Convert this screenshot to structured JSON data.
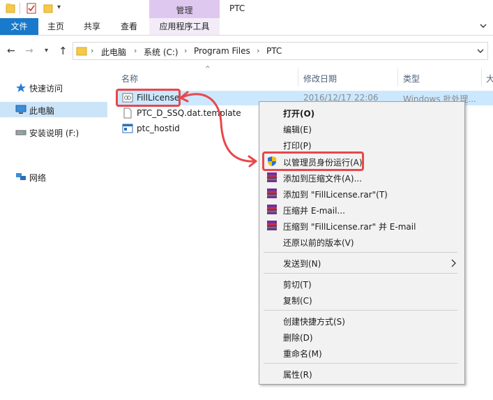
{
  "window": {
    "title": "PTC"
  },
  "ribbon": {
    "context_group": "管理",
    "tabs": [
      "文件",
      "主页",
      "共享",
      "查看",
      "应用程序工具"
    ]
  },
  "address": {
    "crumbs": [
      "此电脑",
      "系统 (C:)",
      "Program Files",
      "PTC"
    ]
  },
  "nav": {
    "items": [
      {
        "label": "快速访问",
        "icon": "star-icon"
      },
      {
        "label": "此电脑",
        "icon": "computer-icon"
      },
      {
        "label": "安装说明 (F:)",
        "icon": "drive-icon"
      },
      {
        "label": "网络",
        "icon": "network-icon"
      }
    ]
  },
  "filelist": {
    "columns": [
      "名称",
      "修改日期",
      "类型",
      "大"
    ],
    "files": [
      {
        "name": "FillLicense",
        "date": "2016/12/17 22:06",
        "type": "Windows 批处理...",
        "icon": "batch-file-icon"
      },
      {
        "name": "PTC_D_SSQ.dat.template",
        "date": "",
        "type": "",
        "icon": "document-icon"
      },
      {
        "name": "ptc_hostid",
        "date": "",
        "type": "",
        "icon": "window-file-icon"
      }
    ]
  },
  "context_menu": {
    "items": [
      "打开(O)",
      "编辑(E)",
      "打印(P)",
      "以管理员身份运行(A)",
      "添加到压缩文件(A)...",
      "添加到 \"FillLicense.rar\"(T)",
      "压缩并 E-mail...",
      "压缩到 \"FillLicense.rar\" 并 E-mail",
      "还原以前的版本(V)",
      "发送到(N)",
      "剪切(T)",
      "复制(C)",
      "创建快捷方式(S)",
      "删除(D)",
      "重命名(M)",
      "属性(R)"
    ]
  },
  "colors": {
    "accent": "#1979ca",
    "selection": "#cce8ff",
    "highlight": "#e8474b",
    "context_tab": "#dfc8f0"
  }
}
